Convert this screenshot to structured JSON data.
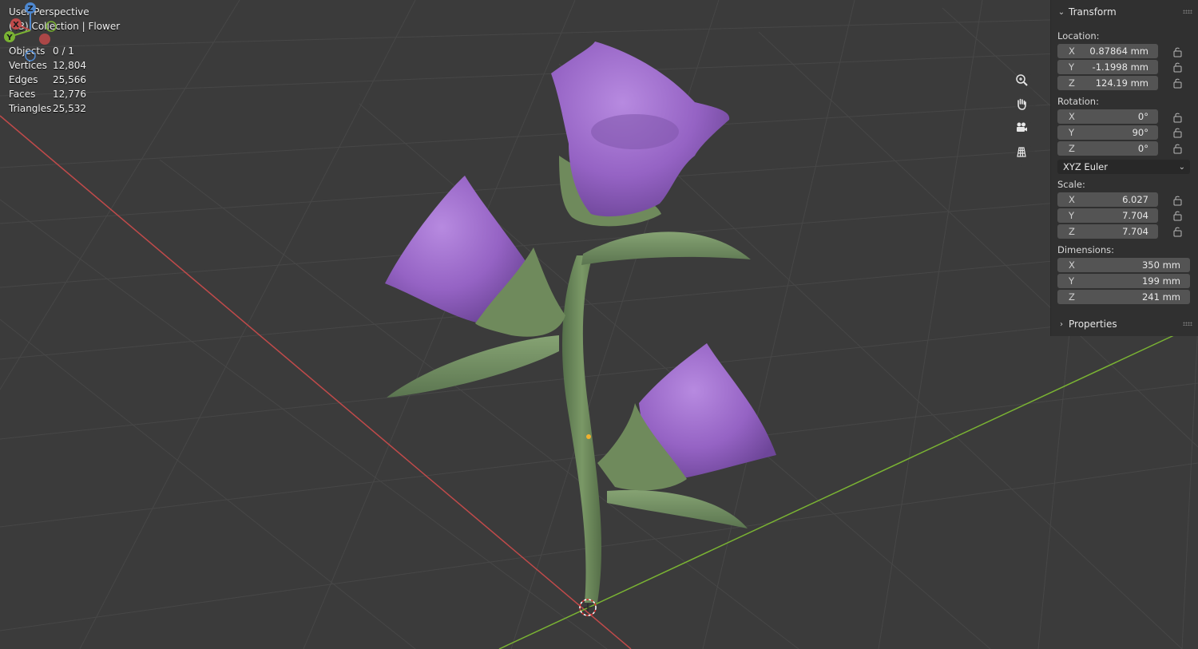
{
  "viewport": {
    "title": "User Perspective",
    "collection": "(43) Collection | Flower",
    "stats": [
      {
        "label": "Objects",
        "value": "0 / 1"
      },
      {
        "label": "Vertices",
        "value": "12,804"
      },
      {
        "label": "Edges",
        "value": "25,566"
      },
      {
        "label": "Faces",
        "value": "12,776"
      },
      {
        "label": "Triangles",
        "value": "25,532"
      }
    ],
    "gizmo": {
      "z": "Z",
      "x": "X",
      "y": "Y"
    },
    "nav_icons": [
      "zoom-icon",
      "hand-pan-icon",
      "camera-icon",
      "grid-ortho-icon"
    ],
    "colors": {
      "background": "#3b3b3b",
      "x_axis": "#c04a4a",
      "y_axis": "#7ab333",
      "petal": "#9b6ac8",
      "stem": "#6f8a5c"
    }
  },
  "sidebar": {
    "transform_title": "Transform",
    "location_label": "Location:",
    "location": [
      {
        "axis": "X",
        "value": "0.87864 mm"
      },
      {
        "axis": "Y",
        "value": "-1.1998 mm"
      },
      {
        "axis": "Z",
        "value": "124.19 mm"
      }
    ],
    "rotation_label": "Rotation:",
    "rotation": [
      {
        "axis": "X",
        "value": "0°"
      },
      {
        "axis": "Y",
        "value": "90°"
      },
      {
        "axis": "Z",
        "value": "0°"
      }
    ],
    "rotation_mode": "XYZ Euler",
    "scale_label": "Scale:",
    "scale": [
      {
        "axis": "X",
        "value": "6.027"
      },
      {
        "axis": "Y",
        "value": "7.704"
      },
      {
        "axis": "Z",
        "value": "7.704"
      }
    ],
    "dimensions_label": "Dimensions:",
    "dimensions": [
      {
        "axis": "X",
        "value": "350 mm"
      },
      {
        "axis": "Y",
        "value": "199 mm"
      },
      {
        "axis": "Z",
        "value": "241 mm"
      }
    ],
    "properties_title": "Properties"
  }
}
